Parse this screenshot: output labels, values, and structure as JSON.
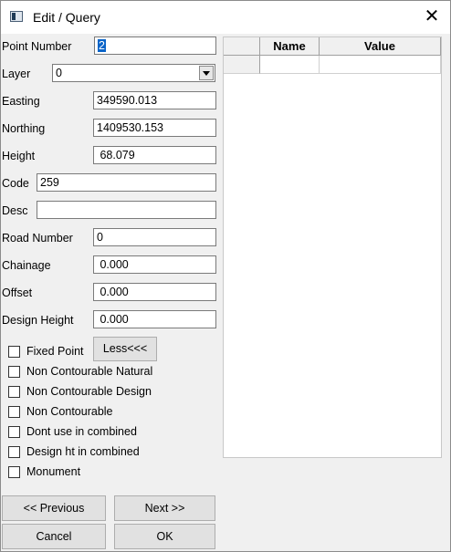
{
  "window": {
    "title": "Edit / Query",
    "close_glyph": "✕"
  },
  "fields": {
    "point_number": {
      "label": "Point Number",
      "value": "2"
    },
    "layer": {
      "label": "Layer",
      "value": "0"
    },
    "easting": {
      "label": "Easting",
      "value": "349590.013"
    },
    "northing": {
      "label": "Northing",
      "value": "1409530.153"
    },
    "height": {
      "label": "Height",
      "value": " 68.079"
    },
    "code": {
      "label": "Code",
      "value": "259"
    },
    "desc": {
      "label": "Desc",
      "value": ""
    },
    "road_number": {
      "label": "Road Number",
      "value": "0"
    },
    "chainage": {
      "label": "Chainage",
      "value": " 0.000"
    },
    "offset": {
      "label": "Offset",
      "value": " 0.000"
    },
    "design_height": {
      "label": "Design Height",
      "value": " 0.000"
    }
  },
  "checkboxes": [
    {
      "label": "Fixed Point",
      "checked": false
    },
    {
      "label": "Non Contourable Natural",
      "checked": false
    },
    {
      "label": "Non Contourable Design",
      "checked": false
    },
    {
      "label": "Non Contourable",
      "checked": false
    },
    {
      "label": "Dont use in combined",
      "checked": false
    },
    {
      "label": "Design ht in combined",
      "checked": false
    },
    {
      "label": "Monument",
      "checked": false
    }
  ],
  "buttons": {
    "less": "Less<<<",
    "previous": "<< Previous",
    "next": "Next >>",
    "cancel": "Cancel",
    "ok": "OK"
  },
  "grid": {
    "columns": [
      "",
      "Name",
      "Value"
    ],
    "rows": [
      [
        "",
        "",
        ""
      ]
    ]
  }
}
